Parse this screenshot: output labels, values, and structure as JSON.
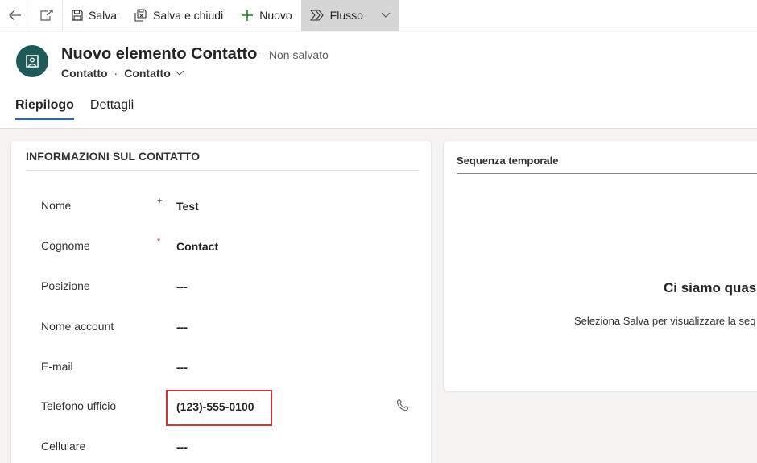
{
  "toolbar": {
    "save_label": "Salva",
    "save_close_label": "Salva e chiudi",
    "new_label": "Nuovo",
    "flow_label": "Flusso"
  },
  "header": {
    "title": "Nuovo elemento Contatto",
    "status": "- Non salvato",
    "entity": "Contatto",
    "form_selector": "Contatto",
    "separator": "·"
  },
  "tabs": [
    {
      "label": "Riepilogo",
      "selected": true
    },
    {
      "label": "Dettagli",
      "selected": false
    }
  ],
  "contact_section": {
    "title": "INFORMAZIONI SUL CONTATTO",
    "fields": [
      {
        "label": "Nome",
        "value": "Test",
        "required": "recommended",
        "marker": "+"
      },
      {
        "label": "Cognome",
        "value": "Contact",
        "required": "required",
        "marker": "*"
      },
      {
        "label": "Posizione",
        "value": "---"
      },
      {
        "label": "Nome account",
        "value": "---"
      },
      {
        "label": "E-mail",
        "value": "---"
      },
      {
        "label": "Telefono ufficio",
        "value": "(123)-555-0100",
        "highlighted": true
      },
      {
        "label": "Cellulare",
        "value": "---"
      }
    ]
  },
  "timeline": {
    "title": "Sequenza temporale",
    "empty_title": "Ci siamo quasi",
    "empty_message": "Seleziona Salva per visualizzare la seq"
  },
  "colors": {
    "accent": "#2564cf",
    "avatar": "#1f5a59",
    "highlight_border": "#d13438",
    "required_red": "#d13438",
    "recommended_blue": "#2b5797",
    "new_plus": "#107c10"
  },
  "icons": {
    "back": "back-arrow-icon",
    "popout": "open-in-new-window-icon",
    "save": "save-icon",
    "save_close": "save-and-close-icon",
    "new": "plus-icon",
    "flow": "flow-icon",
    "chevron": "chevron-down-icon",
    "avatar": "contact-card-icon",
    "phone": "phone-icon"
  }
}
